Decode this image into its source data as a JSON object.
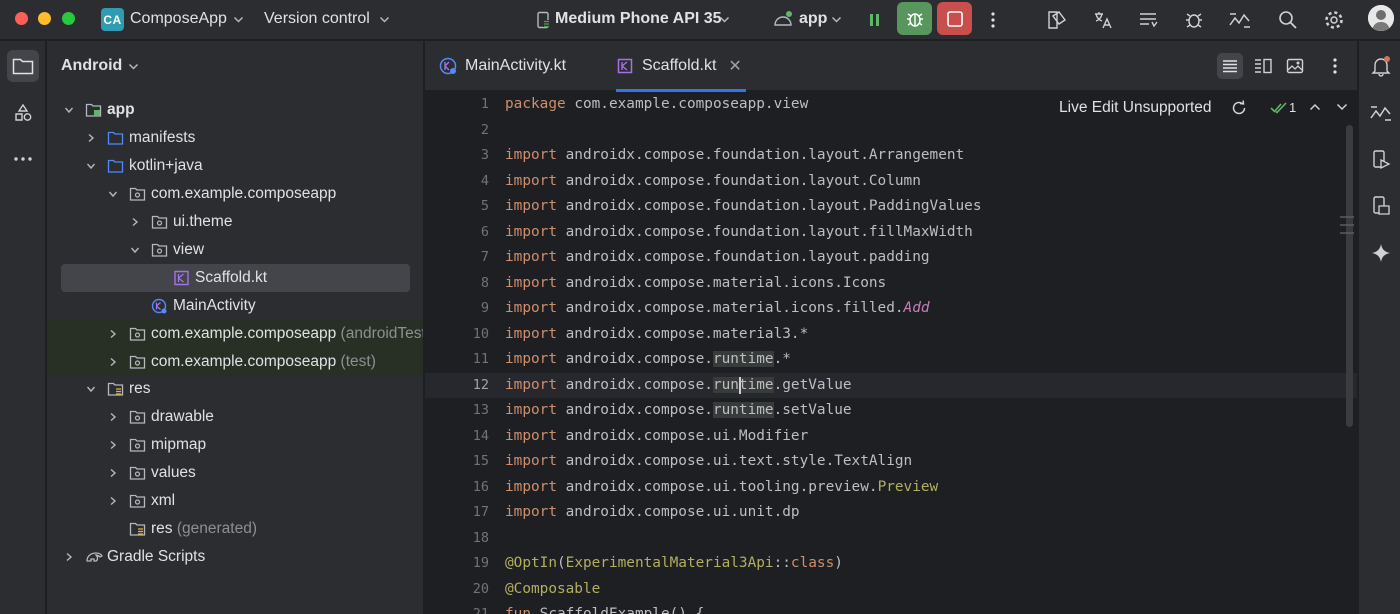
{
  "titlebar": {
    "project_badge": "CA",
    "project_name": "ComposeApp",
    "vcs_label": "Version control",
    "device_label": "Medium Phone API 35",
    "run_config_label": "app"
  },
  "panel": {
    "title": "Android",
    "tree": [
      {
        "label": "app",
        "suffix": "",
        "bold": true
      },
      {
        "label": "manifests",
        "suffix": ""
      },
      {
        "label": "kotlin+java",
        "suffix": ""
      },
      {
        "label": "com.example.composeapp",
        "suffix": ""
      },
      {
        "label": "ui.theme",
        "suffix": ""
      },
      {
        "label": "view",
        "suffix": ""
      },
      {
        "label": "Scaffold.kt",
        "suffix": ""
      },
      {
        "label": "MainActivity",
        "suffix": ""
      },
      {
        "label": "com.example.composeapp",
        "suffix": " (androidTest)"
      },
      {
        "label": "com.example.composeapp",
        "suffix": " (test)"
      },
      {
        "label": "res",
        "suffix": ""
      },
      {
        "label": "drawable",
        "suffix": ""
      },
      {
        "label": "mipmap",
        "suffix": ""
      },
      {
        "label": "values",
        "suffix": ""
      },
      {
        "label": "xml",
        "suffix": ""
      },
      {
        "label": "res",
        "suffix": " (generated)"
      },
      {
        "label": "Gradle Scripts",
        "suffix": ""
      }
    ]
  },
  "tabs": [
    {
      "label": "MainActivity.kt",
      "active": false
    },
    {
      "label": "Scaffold.kt",
      "active": true
    }
  ],
  "editor": {
    "live_edit_label": "Live Edit Unsupported",
    "problems_count": "1",
    "current_line": 12,
    "line_numbers": [
      "1",
      "2",
      "3",
      "4",
      "5",
      "6",
      "7",
      "8",
      "9",
      "10",
      "11",
      "12",
      "13",
      "14",
      "15",
      "16",
      "17",
      "18",
      "19",
      "20",
      "21"
    ],
    "code": {
      "l1_kw": "package",
      "l1_rest": " com.example.composeapp.view",
      "import_kw": "import",
      "l3": " androidx.compose.foundation.layout.Arrangement",
      "l4": " androidx.compose.foundation.layout.Column",
      "l5": " androidx.compose.foundation.layout.PaddingValues",
      "l6": " androidx.compose.foundation.layout.fillMaxWidth",
      "l7": " androidx.compose.foundation.layout.padding",
      "l8": " androidx.compose.material.icons.Icons",
      "l9_a": " androidx.compose.material.icons.filled.",
      "l9_b": "Add",
      "l10": " androidx.compose.material3.*",
      "l11_a": " androidx.compose.",
      "l11_b": "runtime",
      "l11_c": ".*",
      "l12_a": " androidx.compose.",
      "l12_b": "runtime",
      "l12_c": ".getValue",
      "l13_a": " androidx.compose.",
      "l13_b": "runtime",
      "l13_c": ".setValue",
      "l14": " androidx.compose.ui.Modifier",
      "l15": " androidx.compose.ui.text.style.TextAlign",
      "l16_a": " androidx.compose.ui.tooling.preview.",
      "l16_b": "Preview",
      "l17": " androidx.compose.ui.unit.dp",
      "l19_a": "@OptIn",
      "l19_b": "(",
      "l19_c": "ExperimentalMaterial3Api",
      "l19_d": "::",
      "l19_e": "class",
      "l19_f": ")",
      "l20": "@Composable",
      "l21_a": "fun",
      "l21_b": " ScaffoldExample() {"
    }
  }
}
